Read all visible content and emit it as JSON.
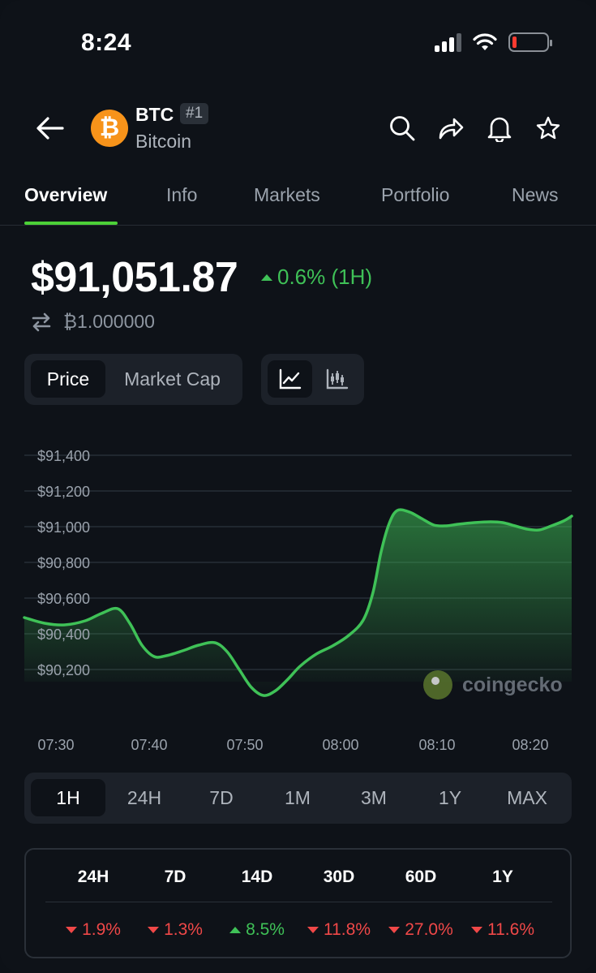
{
  "status_bar": {
    "time": "8:24",
    "battery_level": 0.1
  },
  "header": {
    "symbol": "BTC",
    "rank": "#1",
    "name": "Bitcoin",
    "coin_glyph": "₿",
    "icons": [
      "back-arrow-icon",
      "search-icon",
      "share-icon",
      "bell-icon",
      "star-icon"
    ]
  },
  "tabs": [
    {
      "label": "Overview",
      "active": true
    },
    {
      "label": "Info",
      "active": false
    },
    {
      "label": "Markets",
      "active": false
    },
    {
      "label": "Portfolio",
      "active": false
    },
    {
      "label": "News",
      "active": false
    }
  ],
  "price": {
    "value": "$91,051.87",
    "change": "0.6% (1H)",
    "btc_value": "₿1.000000"
  },
  "metric_toggle": {
    "options": [
      "Price",
      "Market Cap"
    ],
    "selected": "Price"
  },
  "chart_type_toggle": {
    "options": [
      "line-chart-icon",
      "candlestick-icon"
    ],
    "selected": "line-chart-icon"
  },
  "watermark": "coingecko",
  "chart_data": {
    "type": "area",
    "y_ticks": [
      "$91,400",
      "$91,200",
      "$91,000",
      "$90,800",
      "$90,600",
      "$90,400",
      "$90,200"
    ],
    "x_ticks": [
      "07:30",
      "07:40",
      "07:50",
      "08:00",
      "08:10",
      "08:20"
    ],
    "ylim": [
      90050,
      91500
    ],
    "grid": true,
    "series": [
      {
        "color": "#3fc157",
        "x": [
          0,
          0.5,
          1,
          1.5,
          2,
          2.5,
          3,
          3.5,
          4,
          4.5,
          5,
          5.5,
          6,
          6.5,
          7,
          7.5,
          8,
          8.5,
          9,
          9.5,
          10,
          10.5,
          11,
          11.5,
          12,
          12.5,
          13,
          13.5,
          14,
          14.5,
          15,
          15.5,
          16,
          16.5,
          17,
          17.5,
          18,
          18.5,
          19,
          19.5,
          20,
          20.5,
          21,
          21.5,
          22,
          22.5,
          23,
          23.5,
          24,
          24.5,
          25,
          25.5,
          26,
          26.5,
          27,
          27.5,
          28,
          28.5
        ],
        "values": [
          90490,
          90470,
          90450,
          90445,
          90470,
          90510,
          90540,
          90530,
          90400,
          90270,
          90260,
          90290,
          90330,
          90350,
          90345,
          90290,
          90180,
          90100,
          90060,
          90090,
          90150,
          90230,
          90280,
          90320,
          90370,
          90440,
          90560,
          90800,
          91050,
          91100,
          91080,
          91020,
          91000,
          91005,
          91010,
          91020,
          91025,
          91025,
          91020,
          91010,
          90990,
          90985,
          91010,
          91030,
          91050,
          91051.87,
          91051.87,
          91051.87,
          91051.87,
          91051.87,
          91051.87,
          91051.87,
          91051.87,
          91051.87,
          91051.87,
          91051.87,
          91051.87,
          91051.87
        ],
        "x_unit_note_hidden": null
      }
    ]
  },
  "timeframes": {
    "options": [
      "1H",
      "24H",
      "7D",
      "1M",
      "3M",
      "1Y",
      "MAX"
    ],
    "selected": "1H"
  },
  "performance": [
    {
      "period": "24H",
      "value": "1.9%",
      "direction": "down"
    },
    {
      "period": "7D",
      "value": "1.3%",
      "direction": "down"
    },
    {
      "period": "14D",
      "value": "8.5%",
      "direction": "up"
    },
    {
      "period": "30D",
      "value": "11.8%",
      "direction": "down"
    },
    {
      "period": "60D",
      "value": "27.0%",
      "direction": "down"
    },
    {
      "period": "1Y",
      "value": "11.6%",
      "direction": "down"
    }
  ]
}
